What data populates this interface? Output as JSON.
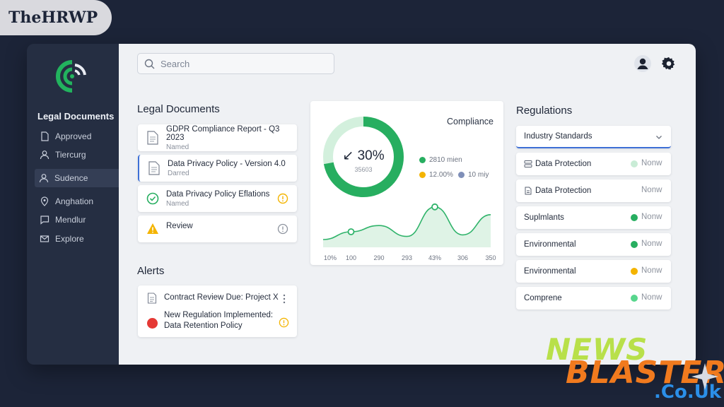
{
  "watermark_top": "TheHRWP",
  "watermark_bottom": {
    "news": "NEWS",
    "blaster": "BLASTER",
    "domain": ".Co.Uk"
  },
  "colors": {
    "accent_green": "#27ae60",
    "amber": "#f4b400",
    "red": "#e53935",
    "blue": "#3d6fd6"
  },
  "sidebar": {
    "title": "Legal Documents",
    "items": [
      {
        "label": "Approved",
        "icon": "document-icon"
      },
      {
        "label": "Tiercurg",
        "icon": "user-icon"
      },
      {
        "label": "Sudence",
        "icon": "user-icon"
      },
      {
        "label": "Anghation",
        "icon": "location-icon"
      },
      {
        "label": "Mendlur",
        "icon": "chat-icon"
      },
      {
        "label": "Explore",
        "icon": "mail-icon"
      }
    ]
  },
  "header": {
    "search_placeholder": "Search"
  },
  "legal_documents": {
    "title": "Legal Documents",
    "items": [
      {
        "title": "GDPR Compliance Report - Q3 2023",
        "sub": "Named",
        "icon": "document-icon"
      },
      {
        "title": "Data Privacy Policy - Version 4.0",
        "sub": "Darred",
        "icon": "document-icon"
      },
      {
        "title": "Data Privacy Policy Eflations",
        "sub": "Named",
        "icon": "check-circle-icon",
        "status_icon": "alert-circle-icon"
      },
      {
        "title": "Review",
        "sub": "",
        "icon": "warning-icon",
        "status_icon": "info-circle-icon"
      }
    ]
  },
  "compliance": {
    "title": "Compliance",
    "gauge_value": "↙ 30%",
    "gauge_sub": "35603",
    "gauge_fraction": 0.72,
    "legend": [
      {
        "label": "2810 mien",
        "color": "#27ae60"
      },
      {
        "label": "12.00%",
        "color": "#f4b400"
      },
      {
        "label": "10 miy",
        "color": "#7f8fb8"
      }
    ]
  },
  "chart_data": {
    "type": "area",
    "categories": [
      "10%",
      "100",
      "290",
      "293",
      "43%",
      "306",
      "350"
    ],
    "values": [
      10,
      20,
      28,
      14,
      52,
      16,
      42
    ],
    "ylim": [
      0,
      60
    ]
  },
  "alerts": {
    "title": "Alerts",
    "items": [
      {
        "title": "Contract Review Due: Project X",
        "icon": "document-icon",
        "action_icon": "more-vertical-icon"
      },
      {
        "title": "New Regulation Implemented:",
        "title2": "Data Retention Policy",
        "icon": "red-dot-icon",
        "action_icon": "alert-circle-icon"
      }
    ]
  },
  "regulations": {
    "title": "Regulations",
    "dropdown": "Industry Standards",
    "items": [
      {
        "label": "Data Protection",
        "status": "Nonw",
        "dot": "#c9ecd6",
        "icon": "database-icon"
      },
      {
        "label": "Data Protection",
        "status": "Nonw",
        "dot": "",
        "icon": "document-icon"
      },
      {
        "label": "Suplmlants",
        "status": "Nonw",
        "dot": "#27ae60"
      },
      {
        "label": "Environmental",
        "status": "Nonw",
        "dot": "#27ae60"
      },
      {
        "label": "Environmental",
        "status": "Nonw",
        "dot": "#f4b400"
      },
      {
        "label": "Comprene",
        "status": "Nonw",
        "dot": "#58d68d"
      }
    ]
  }
}
